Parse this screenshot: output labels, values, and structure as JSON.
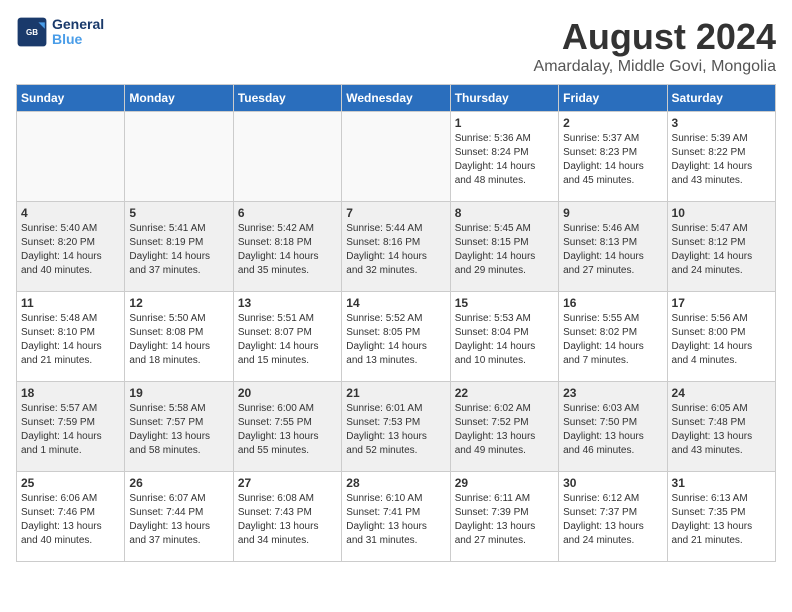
{
  "header": {
    "logo_text_general": "General",
    "logo_text_blue": "Blue",
    "month": "August 2024",
    "location": "Amardalay, Middle Govi, Mongolia"
  },
  "days_of_week": [
    "Sunday",
    "Monday",
    "Tuesday",
    "Wednesday",
    "Thursday",
    "Friday",
    "Saturday"
  ],
  "weeks": [
    [
      {
        "day": "",
        "empty": true
      },
      {
        "day": "",
        "empty": true
      },
      {
        "day": "",
        "empty": true
      },
      {
        "day": "",
        "empty": true
      },
      {
        "day": "1",
        "sunrise": "5:36 AM",
        "sunset": "8:24 PM",
        "daylight": "14 hours and 48 minutes."
      },
      {
        "day": "2",
        "sunrise": "5:37 AM",
        "sunset": "8:23 PM",
        "daylight": "14 hours and 45 minutes."
      },
      {
        "day": "3",
        "sunrise": "5:39 AM",
        "sunset": "8:22 PM",
        "daylight": "14 hours and 43 minutes."
      }
    ],
    [
      {
        "day": "4",
        "sunrise": "5:40 AM",
        "sunset": "8:20 PM",
        "daylight": "14 hours and 40 minutes."
      },
      {
        "day": "5",
        "sunrise": "5:41 AM",
        "sunset": "8:19 PM",
        "daylight": "14 hours and 37 minutes."
      },
      {
        "day": "6",
        "sunrise": "5:42 AM",
        "sunset": "8:18 PM",
        "daylight": "14 hours and 35 minutes."
      },
      {
        "day": "7",
        "sunrise": "5:44 AM",
        "sunset": "8:16 PM",
        "daylight": "14 hours and 32 minutes."
      },
      {
        "day": "8",
        "sunrise": "5:45 AM",
        "sunset": "8:15 PM",
        "daylight": "14 hours and 29 minutes."
      },
      {
        "day": "9",
        "sunrise": "5:46 AM",
        "sunset": "8:13 PM",
        "daylight": "14 hours and 27 minutes."
      },
      {
        "day": "10",
        "sunrise": "5:47 AM",
        "sunset": "8:12 PM",
        "daylight": "14 hours and 24 minutes."
      }
    ],
    [
      {
        "day": "11",
        "sunrise": "5:48 AM",
        "sunset": "8:10 PM",
        "daylight": "14 hours and 21 minutes."
      },
      {
        "day": "12",
        "sunrise": "5:50 AM",
        "sunset": "8:08 PM",
        "daylight": "14 hours and 18 minutes."
      },
      {
        "day": "13",
        "sunrise": "5:51 AM",
        "sunset": "8:07 PM",
        "daylight": "14 hours and 15 minutes."
      },
      {
        "day": "14",
        "sunrise": "5:52 AM",
        "sunset": "8:05 PM",
        "daylight": "14 hours and 13 minutes."
      },
      {
        "day": "15",
        "sunrise": "5:53 AM",
        "sunset": "8:04 PM",
        "daylight": "14 hours and 10 minutes."
      },
      {
        "day": "16",
        "sunrise": "5:55 AM",
        "sunset": "8:02 PM",
        "daylight": "14 hours and 7 minutes."
      },
      {
        "day": "17",
        "sunrise": "5:56 AM",
        "sunset": "8:00 PM",
        "daylight": "14 hours and 4 minutes."
      }
    ],
    [
      {
        "day": "18",
        "sunrise": "5:57 AM",
        "sunset": "7:59 PM",
        "daylight": "14 hours and 1 minute."
      },
      {
        "day": "19",
        "sunrise": "5:58 AM",
        "sunset": "7:57 PM",
        "daylight": "13 hours and 58 minutes."
      },
      {
        "day": "20",
        "sunrise": "6:00 AM",
        "sunset": "7:55 PM",
        "daylight": "13 hours and 55 minutes."
      },
      {
        "day": "21",
        "sunrise": "6:01 AM",
        "sunset": "7:53 PM",
        "daylight": "13 hours and 52 minutes."
      },
      {
        "day": "22",
        "sunrise": "6:02 AM",
        "sunset": "7:52 PM",
        "daylight": "13 hours and 49 minutes."
      },
      {
        "day": "23",
        "sunrise": "6:03 AM",
        "sunset": "7:50 PM",
        "daylight": "13 hours and 46 minutes."
      },
      {
        "day": "24",
        "sunrise": "6:05 AM",
        "sunset": "7:48 PM",
        "daylight": "13 hours and 43 minutes."
      }
    ],
    [
      {
        "day": "25",
        "sunrise": "6:06 AM",
        "sunset": "7:46 PM",
        "daylight": "13 hours and 40 minutes."
      },
      {
        "day": "26",
        "sunrise": "6:07 AM",
        "sunset": "7:44 PM",
        "daylight": "13 hours and 37 minutes."
      },
      {
        "day": "27",
        "sunrise": "6:08 AM",
        "sunset": "7:43 PM",
        "daylight": "13 hours and 34 minutes."
      },
      {
        "day": "28",
        "sunrise": "6:10 AM",
        "sunset": "7:41 PM",
        "daylight": "13 hours and 31 minutes."
      },
      {
        "day": "29",
        "sunrise": "6:11 AM",
        "sunset": "7:39 PM",
        "daylight": "13 hours and 27 minutes."
      },
      {
        "day": "30",
        "sunrise": "6:12 AM",
        "sunset": "7:37 PM",
        "daylight": "13 hours and 24 minutes."
      },
      {
        "day": "31",
        "sunrise": "6:13 AM",
        "sunset": "7:35 PM",
        "daylight": "13 hours and 21 minutes."
      }
    ]
  ]
}
